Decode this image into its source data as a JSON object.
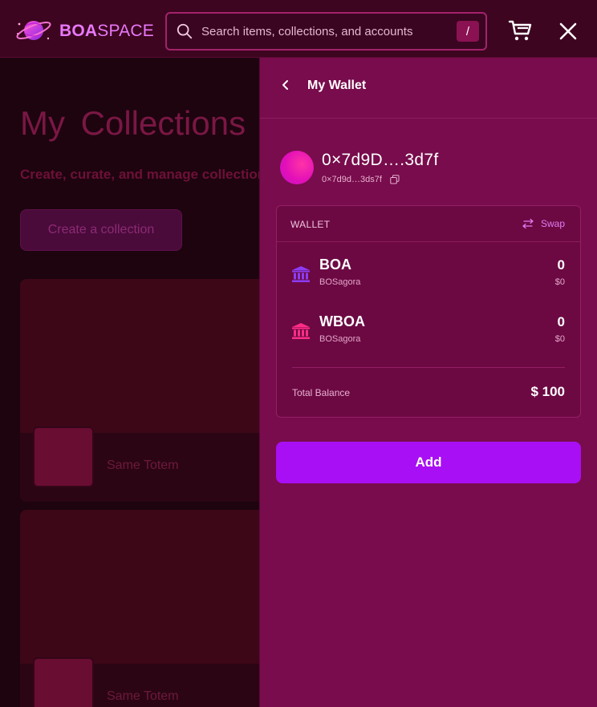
{
  "header": {
    "logo": {
      "brand_bold": "BOA",
      "brand_regular": "SPACE"
    },
    "search": {
      "placeholder": "Search items, collections, and accounts",
      "shortcut": "/"
    },
    "icons": {
      "search": "search-icon",
      "cart": "cart-icon",
      "close": "close-icon"
    }
  },
  "background_page": {
    "title": "My  Collections",
    "subtitle": "Create, curate, and manage collections",
    "create_button": "Create a collection",
    "cards": [
      {
        "name": "Same Totem"
      },
      {
        "name": "Same Totem"
      }
    ]
  },
  "wallet_panel": {
    "title": "My Wallet",
    "address": "0×7d9D….3d7f",
    "address_short": "0×7d9d…3ds7f",
    "box": {
      "label": "WALLET",
      "swap_label": "Swap",
      "tokens": [
        {
          "name": "BOA",
          "network": "BOSagora",
          "amount": "0",
          "fiat": "$0",
          "icon": "bank-icon",
          "icon_color": "#8b3df5"
        },
        {
          "name": "WBOA",
          "network": "BOSagora",
          "amount": "0",
          "fiat": "$0",
          "icon": "bank-icon",
          "icon_color": "#ff2d87"
        }
      ],
      "total_label": "Total Balance",
      "total_value": "$ 100"
    },
    "add_button": "Add"
  },
  "colors": {
    "header_bg": "#3d0520",
    "panel_bg": "#780c4c",
    "accent_purple": "#a80ff4",
    "brand_pink": "#e879f9"
  }
}
